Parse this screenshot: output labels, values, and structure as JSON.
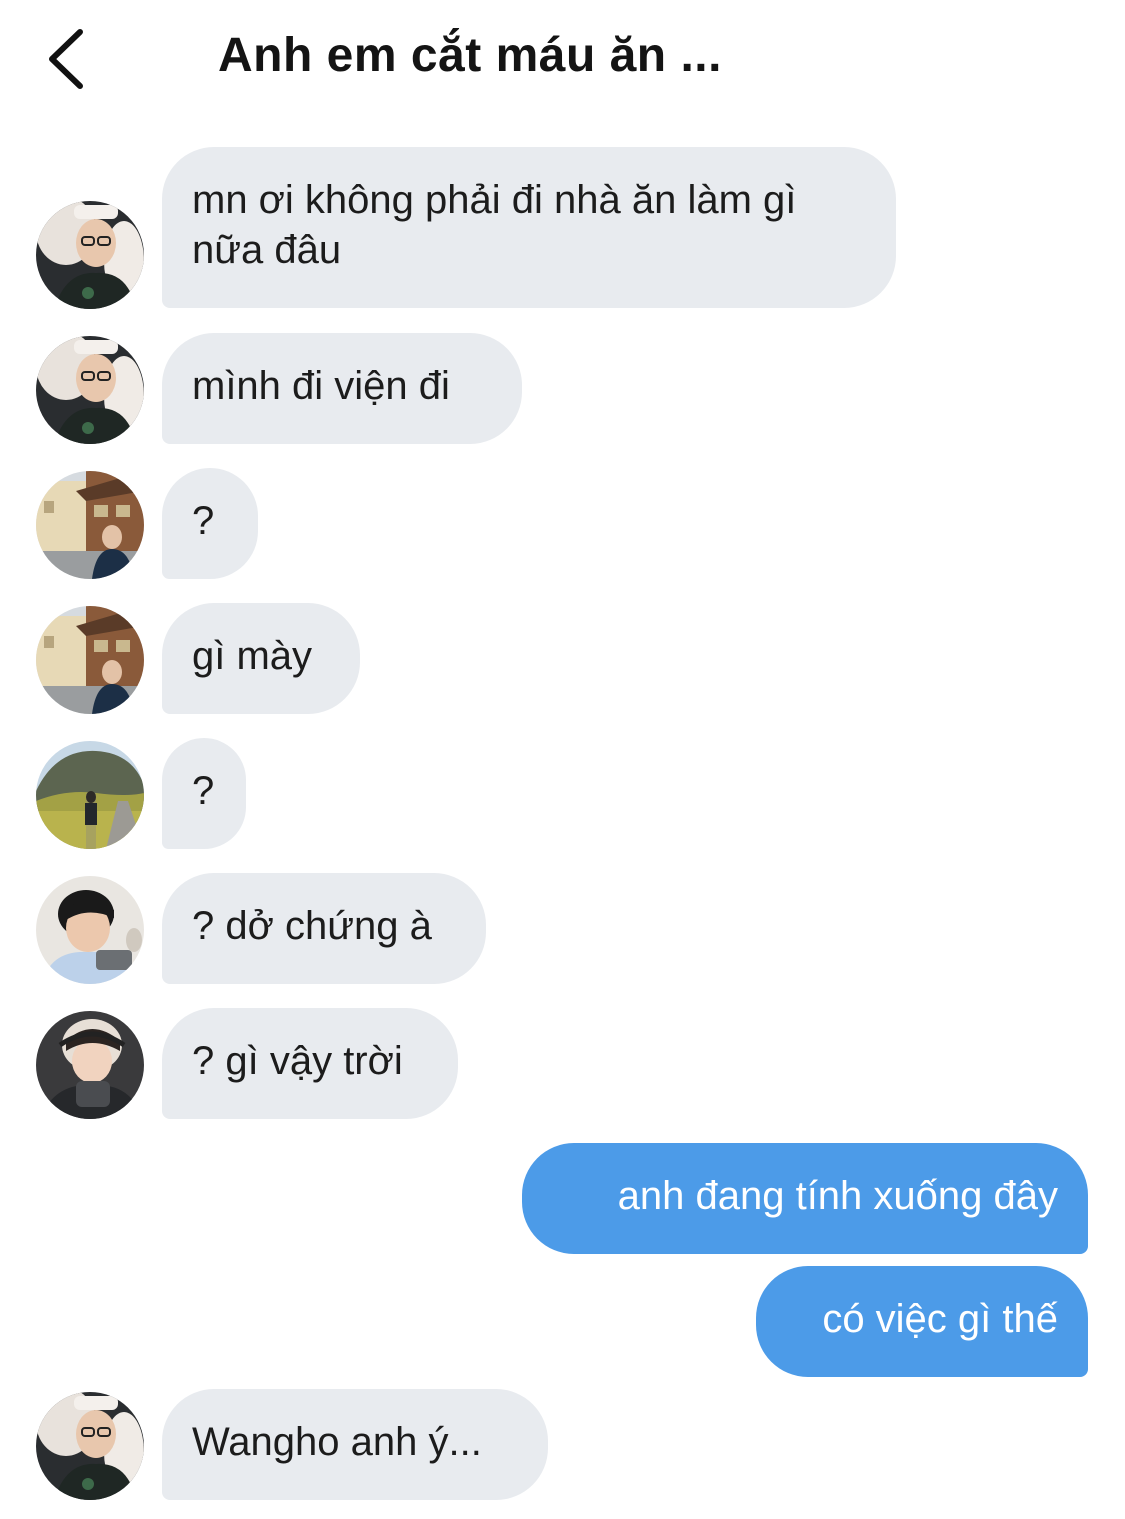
{
  "header": {
    "title": "Anh em cắt máu ăn ...",
    "back_icon": "chevron-left-icon"
  },
  "messages": [
    {
      "direction": "incoming",
      "sender_avatar": "avatar-glasses-hoodie",
      "text": "mn ơi không phải đi nhà ăn làm gì nữa đâu"
    },
    {
      "direction": "incoming",
      "sender_avatar": "avatar-glasses-hoodie",
      "text": "mình đi viện đi"
    },
    {
      "direction": "incoming",
      "sender_avatar": "avatar-street-house",
      "text": "?"
    },
    {
      "direction": "incoming",
      "sender_avatar": "avatar-street-house",
      "text": "gì mày"
    },
    {
      "direction": "incoming",
      "sender_avatar": "avatar-mountain-path",
      "text": "?"
    },
    {
      "direction": "incoming",
      "sender_avatar": "avatar-boy-phone",
      "text": "? dở chứng à"
    },
    {
      "direction": "incoming",
      "sender_avatar": "avatar-headset-gamer",
      "text": "? gì vậy trời"
    },
    {
      "direction": "outgoing",
      "text": "anh đang tính xuống đây"
    },
    {
      "direction": "outgoing",
      "text": "có việc gì thế"
    },
    {
      "direction": "incoming",
      "sender_avatar": "avatar-glasses-hoodie",
      "text": "Wangho anh ý..."
    }
  ],
  "colors": {
    "incoming_bubble": "#e8ebef",
    "outgoing_bubble": "#4c9be8",
    "title_text": "#141414"
  }
}
